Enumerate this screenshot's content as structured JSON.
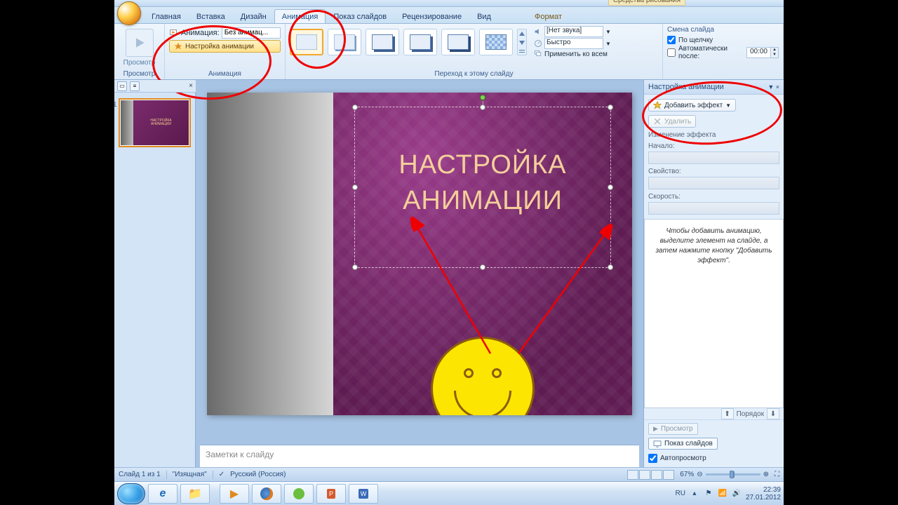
{
  "title_contextual": "Средства рисования",
  "tabs": {
    "home": "Главная",
    "insert": "Вставка",
    "design": "Дизайн",
    "animation": "Анимация",
    "slideshow": "Показ слайдов",
    "review": "Рецензирование",
    "view": "Вид",
    "format": "Формат"
  },
  "ribbon": {
    "preview_group": "Просмотр",
    "preview_label": "Просмотр",
    "anim_group": "Анимация",
    "anim_label": "Анимация:",
    "anim_combo": "Без анимац...",
    "anim_settings": "Настройка анимации",
    "transition_group": "Переход к этому слайду",
    "sound_label": "[Нет звука]",
    "speed_label": "Быстро",
    "apply_all": "Применить ко всем",
    "advance_title": "Смена слайда",
    "on_click": "По щелчку",
    "auto_after": "Автоматически после:",
    "auto_time": "00:00"
  },
  "slide": {
    "title_line1": "НАСТРОЙКА",
    "title_line2": "АНИМАЦИИ"
  },
  "notes_placeholder": "Заметки к слайду",
  "status": {
    "slide_of": "Слайд 1 из 1",
    "theme": "\"Изящная\"",
    "lang": "Русский (Россия)",
    "zoom": "67%"
  },
  "taskpane": {
    "title": "Настройка анимации",
    "add_effect": "Добавить эффект",
    "remove": "Удалить",
    "mod_title": "Изменение эффекта",
    "start": "Начало:",
    "property": "Свойство:",
    "speed": "Скорость:",
    "hint": "Чтобы добавить анимацию, выделите элемент на слайде, а затем нажмите кнопку \"Добавить эффект\".",
    "order": "Порядок",
    "play": "Просмотр",
    "slideshow": "Показ слайдов",
    "autopreview": "Автопросмотр"
  },
  "taskbar": {
    "lang": "RU",
    "time": "22:39",
    "date": "27.01.2012"
  }
}
